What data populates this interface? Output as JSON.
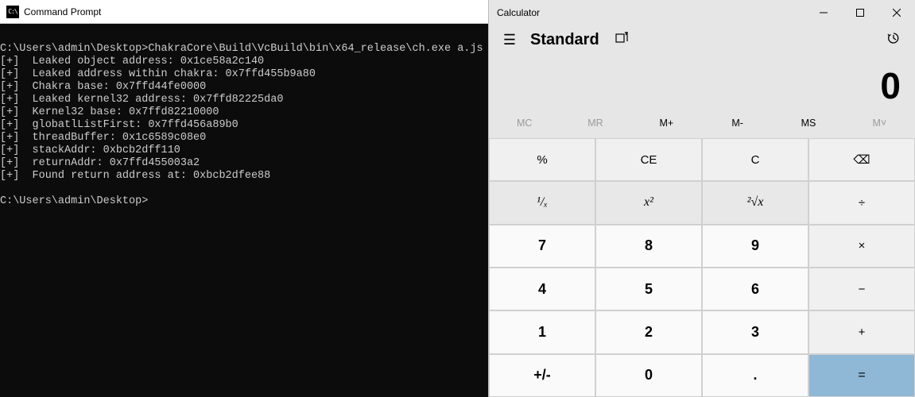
{
  "cmd": {
    "title": "Command Prompt",
    "lines": [
      "C:\\Users\\admin\\Desktop>ChakraCore\\Build\\VcBuild\\bin\\x64_release\\ch.exe a.js",
      "[+]  Leaked object address: 0x1ce58a2c140",
      "[+]  Leaked address within chakra: 0x7ffd455b9a80",
      "[+]  Chakra base: 0x7ffd44fe0000",
      "[+]  Leaked kernel32 address: 0x7ffd82225da0",
      "[+]  Kernel32 base: 0x7ffd82210000",
      "[+]  globatlListFirst: 0x7ffd456a89b0",
      "[+]  threadBuffer: 0x1c6589c08e0",
      "[+]  stackAddr: 0xbcb2dff110",
      "[+]  returnAddr: 0x7ffd455003a2",
      "[+]  Found return address at: 0xbcb2dfee88",
      "",
      "C:\\Users\\admin\\Desktop>"
    ]
  },
  "calc": {
    "title": "Calculator",
    "mode": "Standard",
    "display": "0",
    "memory": {
      "mc": "MC",
      "mr": "MR",
      "mplus": "M+",
      "mminus": "M-",
      "ms": "MS",
      "mlist": "M˅"
    },
    "row1": {
      "percent": "%",
      "ce": "CE",
      "c": "C",
      "back": "⌫"
    },
    "row2": {
      "recip": "¹/ₓ",
      "square": "x²",
      "sqrt": "²√x",
      "div": "÷"
    },
    "row3": {
      "n7": "7",
      "n8": "8",
      "n9": "9",
      "mul": "×"
    },
    "row4": {
      "n4": "4",
      "n5": "5",
      "n6": "6",
      "sub": "−"
    },
    "row5": {
      "n1": "1",
      "n2": "2",
      "n3": "3",
      "add": "+"
    },
    "row6": {
      "neg": "+/-",
      "n0": "0",
      "dot": ".",
      "eq": "="
    }
  }
}
